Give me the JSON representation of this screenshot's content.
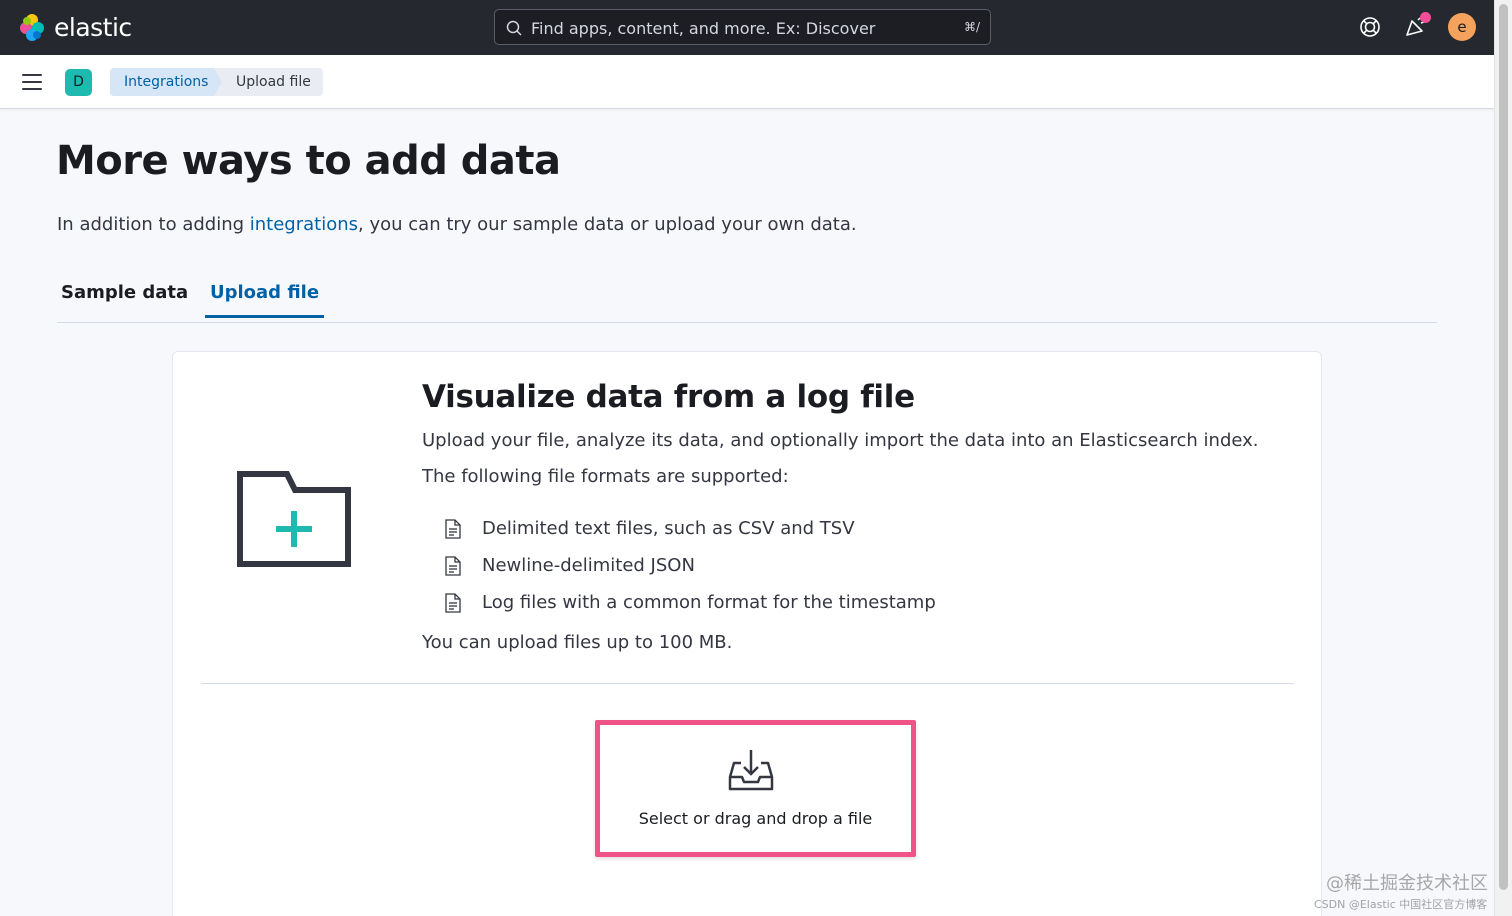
{
  "header": {
    "brand": "elastic",
    "search_placeholder": "Find apps, content, and more. Ex: Discover",
    "search_shortcut": "⌘/",
    "avatar_initial": "e"
  },
  "breadcrumb": {
    "space_initial": "D",
    "items": [
      {
        "label": "Integrations"
      },
      {
        "label": "Upload file"
      }
    ]
  },
  "page": {
    "title": "More ways to add data",
    "desc_prefix": "In addition to adding ",
    "desc_link": "integrations",
    "desc_suffix": ", you can try our sample data or upload your own data.",
    "tabs": [
      {
        "label": "Sample data",
        "selected": false
      },
      {
        "label": "Upload file",
        "selected": true
      }
    ]
  },
  "upload_card": {
    "title": "Visualize data from a log file",
    "intro": "Upload your file, analyze its data, and optionally import the data into an Elasticsearch index.",
    "formats_heading": "The following file formats are supported:",
    "formats": [
      "Delimited text files, such as CSV and TSV",
      "Newline-delimited JSON",
      "Log files with a common format for the timestamp"
    ],
    "size_limit": "You can upload files up to 100 MB.",
    "dropzone_label": "Select or drag and drop a file"
  },
  "watermark": {
    "line1": "@稀土掘金技术社区",
    "line2": "CSDN @Elastic 中国社区官方博客"
  },
  "colors": {
    "topbar": "#25282f",
    "accent": "#0061a6",
    "teal": "#1ebab0",
    "highlight": "#ef5387",
    "avatar": "#f5a35c"
  }
}
